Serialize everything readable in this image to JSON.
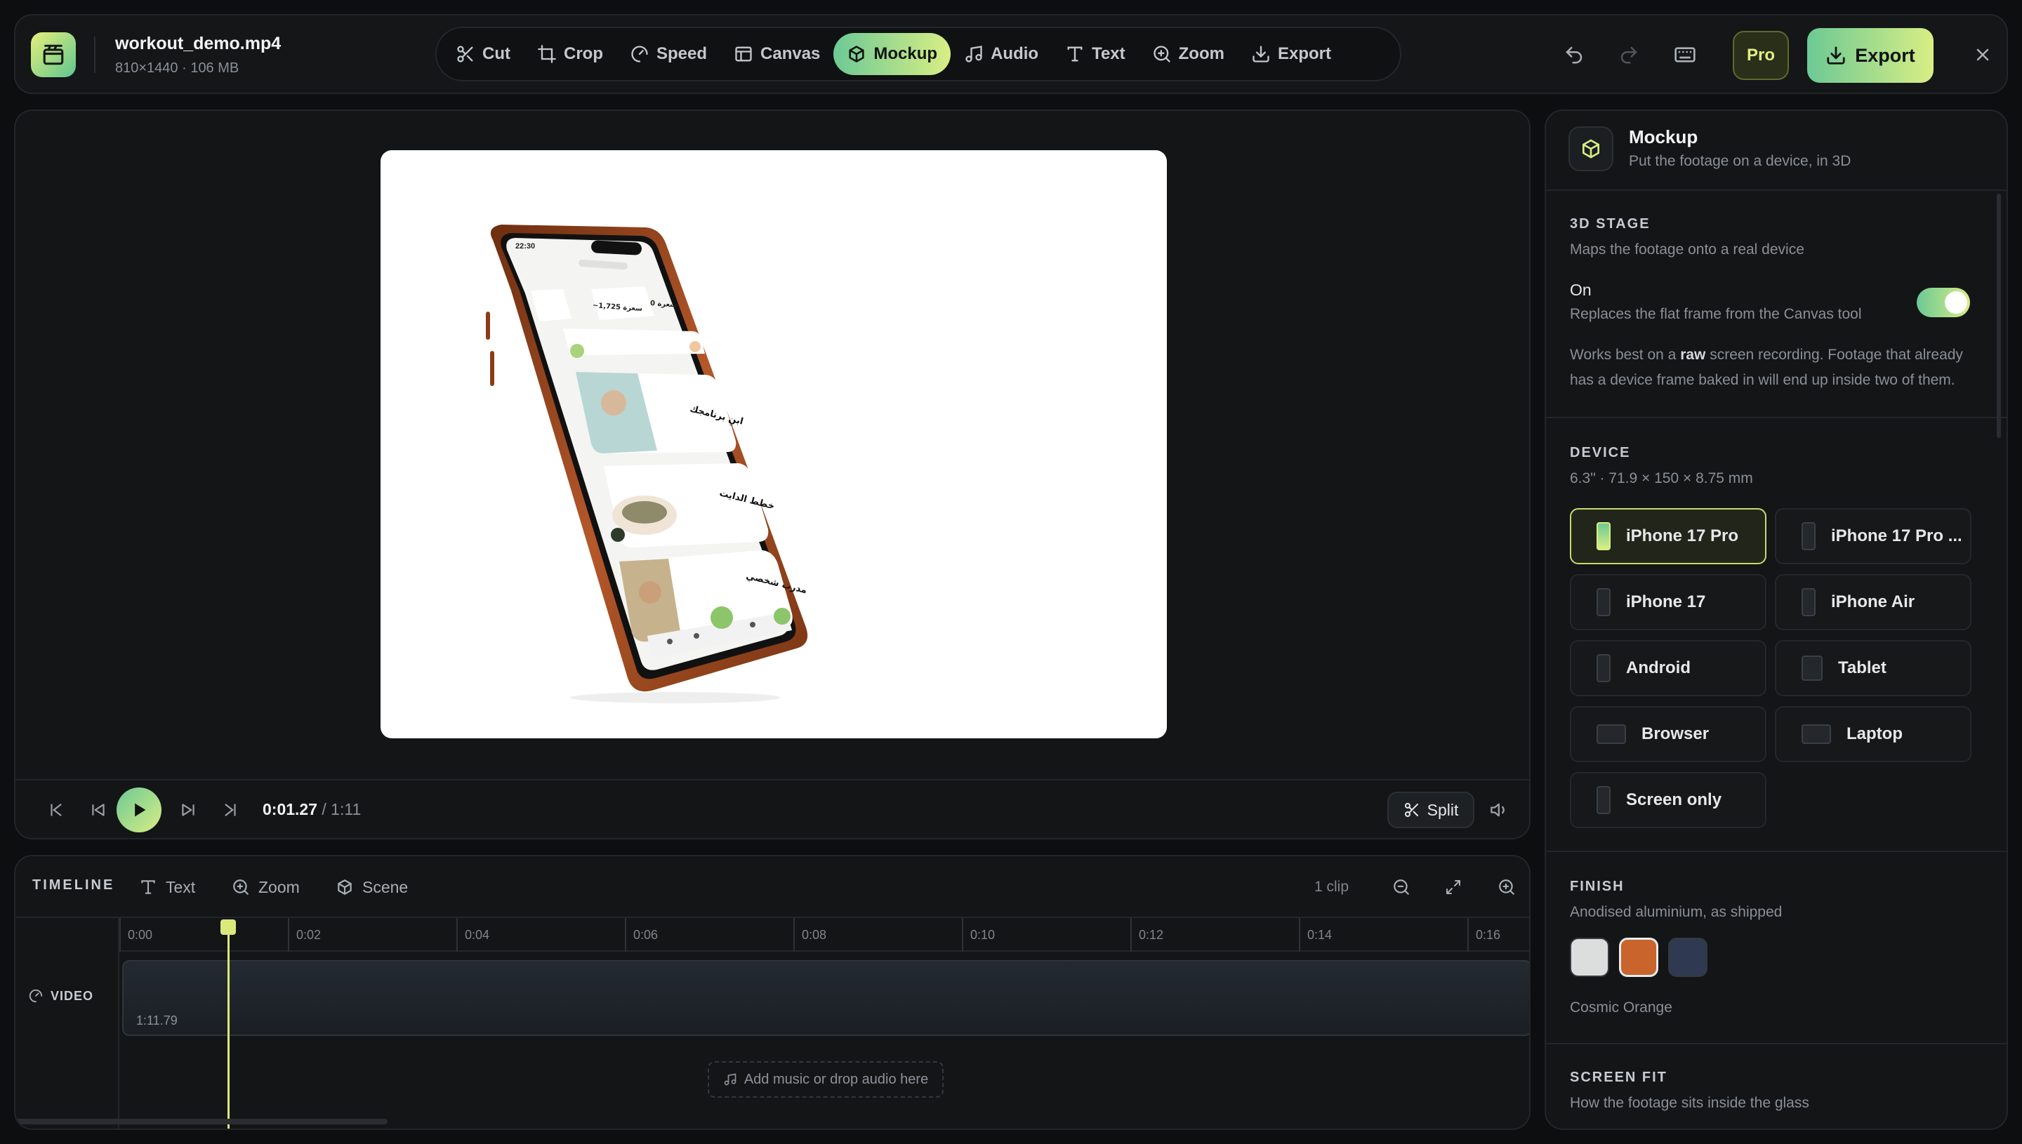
{
  "app": {
    "file_name": "workout_demo.mp4",
    "file_meta": "810×1440 · 106 MB",
    "colors": {
      "accent_start": "#6cc995",
      "accent_end": "#d9ee84",
      "bg": "#0c0e0f"
    }
  },
  "toolbar": {
    "tools": [
      {
        "label": "Cut",
        "icon": "scissors-icon"
      },
      {
        "label": "Crop",
        "icon": "crop-icon"
      },
      {
        "label": "Speed",
        "icon": "gauge-icon"
      },
      {
        "label": "Canvas",
        "icon": "layout-icon"
      },
      {
        "label": "Mockup",
        "icon": "rotate-3d-icon",
        "active": true
      },
      {
        "label": "Audio",
        "icon": "music-note-icon"
      },
      {
        "label": "Text",
        "icon": "text-icon"
      },
      {
        "label": "Zoom",
        "icon": "zoom-in-icon"
      },
      {
        "label": "Export",
        "icon": "download-icon"
      }
    ],
    "pro_label": "Pro",
    "export_label": "Export"
  },
  "preview": {
    "phone": {
      "status_time": "22:30",
      "stat_left": "~1,725 سعرة",
      "stat_right": "0 سعرة"
    },
    "cards": [
      {
        "title": "ابنِ برنامجك"
      },
      {
        "title": "خطط الدايت"
      },
      {
        "title": "مدرب شخصي"
      }
    ]
  },
  "transport": {
    "current_time": "0:01.27",
    "total_time": "/ 1:11",
    "split_label": "Split"
  },
  "timeline": {
    "label": "TIMELINE",
    "buttons": [
      "Text",
      "Zoom",
      "Scene"
    ],
    "clip_count": "1 clip",
    "ticks": [
      "0:00",
      "0:02",
      "0:04",
      "0:06",
      "0:08",
      "0:10",
      "0:12",
      "0:14",
      "0:16"
    ],
    "track_label": "VIDEO",
    "clip_duration": "1:11.79",
    "audio_hint": "Add music or drop audio here"
  },
  "panel": {
    "title": "Mockup",
    "subtitle": "Put the footage on a device, in 3D",
    "stage": {
      "heading": "3D STAGE",
      "sub": "Maps the footage onto a real device",
      "toggle_label": "On",
      "toggle_sub": "Replaces the flat frame from the Canvas tool",
      "toggle_on": true,
      "note_pre": "Works best on a ",
      "note_bold": "raw",
      "note_post": " screen recording. Footage that already has a device frame baked in will end up inside two of them."
    },
    "device": {
      "heading": "DEVICE",
      "sub": "6.3\" · 71.9 × 150 × 8.75 mm",
      "options": [
        {
          "label": "iPhone 17 Pro",
          "shape": "phone",
          "selected": true
        },
        {
          "label": "iPhone 17 Pro ...",
          "shape": "phone"
        },
        {
          "label": "iPhone 17",
          "shape": "phone"
        },
        {
          "label": "iPhone Air",
          "shape": "phone"
        },
        {
          "label": "Android",
          "shape": "phone"
        },
        {
          "label": "Tablet",
          "shape": "tab"
        },
        {
          "label": "Browser",
          "shape": "wide"
        },
        {
          "label": "Laptop",
          "shape": "wide"
        },
        {
          "label": "Screen only",
          "shape": "phone"
        }
      ]
    },
    "finish": {
      "heading": "FINISH",
      "sub": "Anodised aluminium, as shipped",
      "swatches": [
        "#dcdedd",
        "#c8642c",
        "#2f3a52"
      ],
      "selected_name": "Cosmic Orange"
    },
    "screen_fit": {
      "heading": "SCREEN FIT",
      "sub": "How the footage sits inside the glass"
    }
  }
}
